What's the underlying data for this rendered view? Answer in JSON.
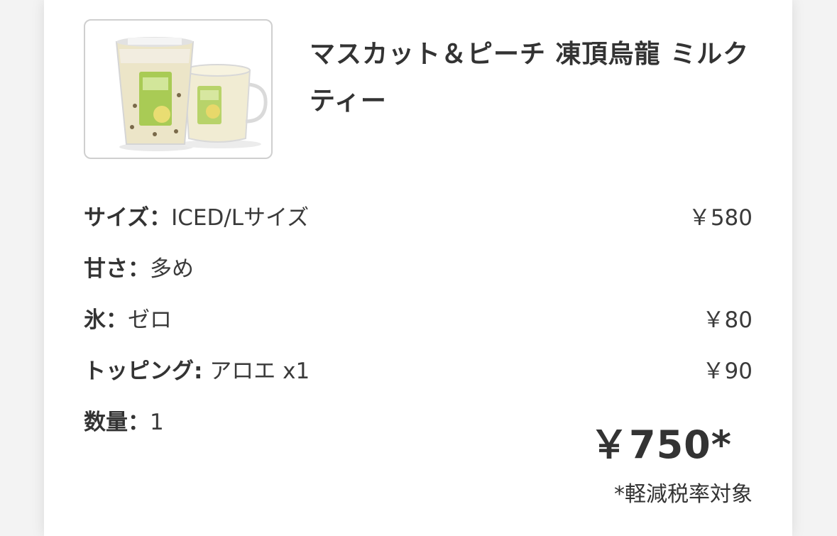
{
  "product": {
    "name": "マスカット＆ピーチ 凍頂烏龍 ミルクティー",
    "image_alt": "マスカット＆ピーチ 凍頂烏龍 ミルクティー"
  },
  "options": [
    {
      "label": "サイズ：",
      "value": "ICED/Lサイズ",
      "price": "￥580"
    },
    {
      "label": "甘さ：",
      "value": "多め",
      "price": ""
    },
    {
      "label": "氷：",
      "value": "ゼロ",
      "price": "￥80"
    },
    {
      "label": "トッピング:",
      "value": " アロエ x1",
      "price": "￥90"
    },
    {
      "label": "数量：",
      "value": "1",
      "price": ""
    }
  ],
  "total": "￥750*",
  "tax_note": "*軽減税率対象",
  "colors": {
    "text": "#333333",
    "border": "#cfcfcf",
    "background": "#ffffff"
  }
}
